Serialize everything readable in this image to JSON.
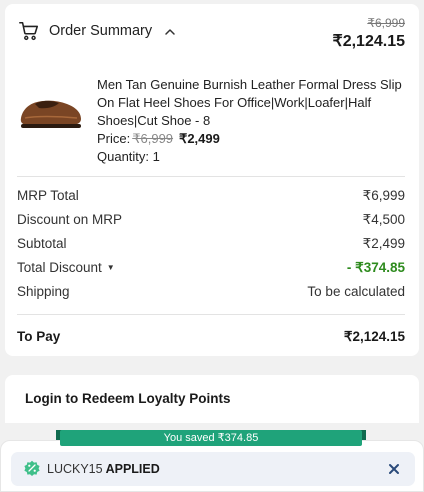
{
  "order_summary": {
    "title": "Order Summary",
    "mrp_strike": "₹6,999",
    "total": "₹2,124.15"
  },
  "product": {
    "name": "Men Tan Genuine Burnish Leather Formal Dress Slip On Flat Heel Shoes For Office|Work|Loafer|Half Shoes|Cut Shoe - 8",
    "price_label": "Price:",
    "price_mrp": "₹6,999",
    "price_sale": "₹2,499",
    "quantity": "Quantity: 1"
  },
  "breakdown": [
    {
      "label": "MRP Total",
      "value": "₹6,999"
    },
    {
      "label": "Discount on MRP",
      "value": "₹4,500"
    },
    {
      "label": "Subtotal",
      "value": "₹2,499"
    },
    {
      "label": "Total Discount",
      "value": "- ₹374.85"
    },
    {
      "label": "Shipping",
      "value": "To be calculated"
    }
  ],
  "to_pay": {
    "label": "To Pay",
    "value": "₹2,124.15"
  },
  "loyalty": {
    "label": "Login to Redeem Loyalty Points"
  },
  "coupon": {
    "saved_text": "You saved ₹374.85",
    "code": "LUCKY15",
    "status": "APPLIED"
  },
  "colors": {
    "discount_green": "#2e8b1e",
    "ribbon_green": "#1fa37a",
    "coupon_icon": "#3fbf8a"
  },
  "icons": [
    "cart-icon",
    "chevron-up-icon",
    "caret-down-icon",
    "coupon-icon",
    "close-icon"
  ]
}
